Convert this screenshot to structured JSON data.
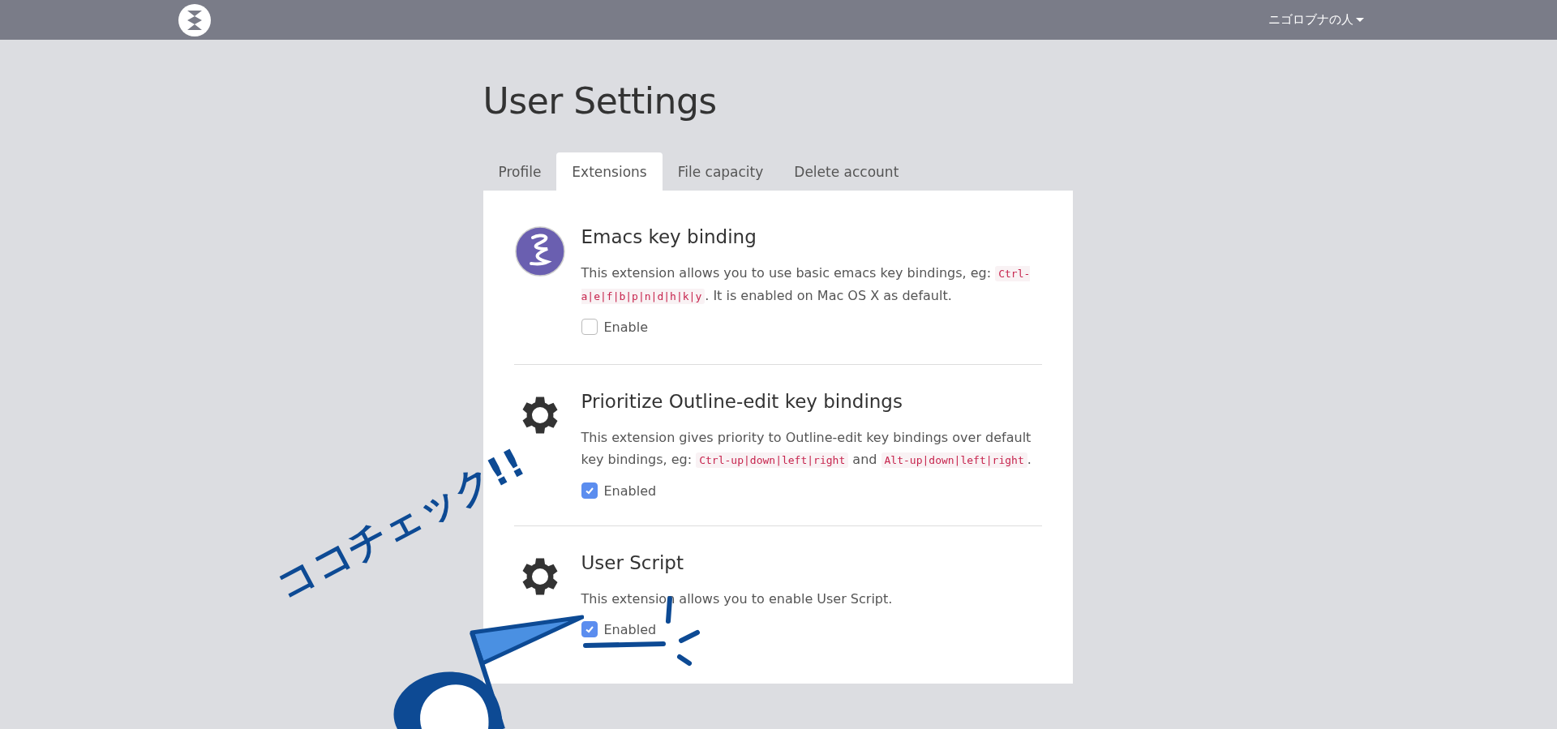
{
  "navbar": {
    "user_menu": "ニゴロブナの人"
  },
  "page": {
    "title": "User Settings"
  },
  "tabs": [
    {
      "label": "Profile",
      "selected": false
    },
    {
      "label": "Extensions",
      "selected": true
    },
    {
      "label": "File capacity",
      "selected": false
    },
    {
      "label": "Delete account",
      "selected": false
    }
  ],
  "extensions": [
    {
      "kind": "emacs",
      "title": "Emacs key binding",
      "description": [
        {
          "text": "This extension allows you to use basic emacs key bindings, eg: ",
          "code": false
        },
        {
          "text": "Ctrl-a|e|f|b|p|n|d|h|k|y",
          "code": true
        },
        {
          "text": ". It is enabled on Mac OS X as default.",
          "code": false
        }
      ],
      "checkbox_label": "Enable",
      "checked": false
    },
    {
      "kind": "gear",
      "title": "Prioritize Outline-edit key bindings",
      "description": [
        {
          "text": "This extension gives priority to Outline-edit key bindings over default key bindings, eg: ",
          "code": false
        },
        {
          "text": "Ctrl-up|down|left|right",
          "code": true
        },
        {
          "text": " and ",
          "code": false
        },
        {
          "text": "Alt-up|down|left|right",
          "code": true
        },
        {
          "text": ".",
          "code": false
        }
      ],
      "checkbox_label": "Enabled",
      "checked": true
    },
    {
      "kind": "gear",
      "title": "User Script",
      "description": [
        {
          "text": "This extension allows you to enable User Script.",
          "code": false
        }
      ],
      "checkbox_label": "Enabled",
      "checked": true
    }
  ],
  "annotation": {
    "text": "ココチェック!!"
  }
}
